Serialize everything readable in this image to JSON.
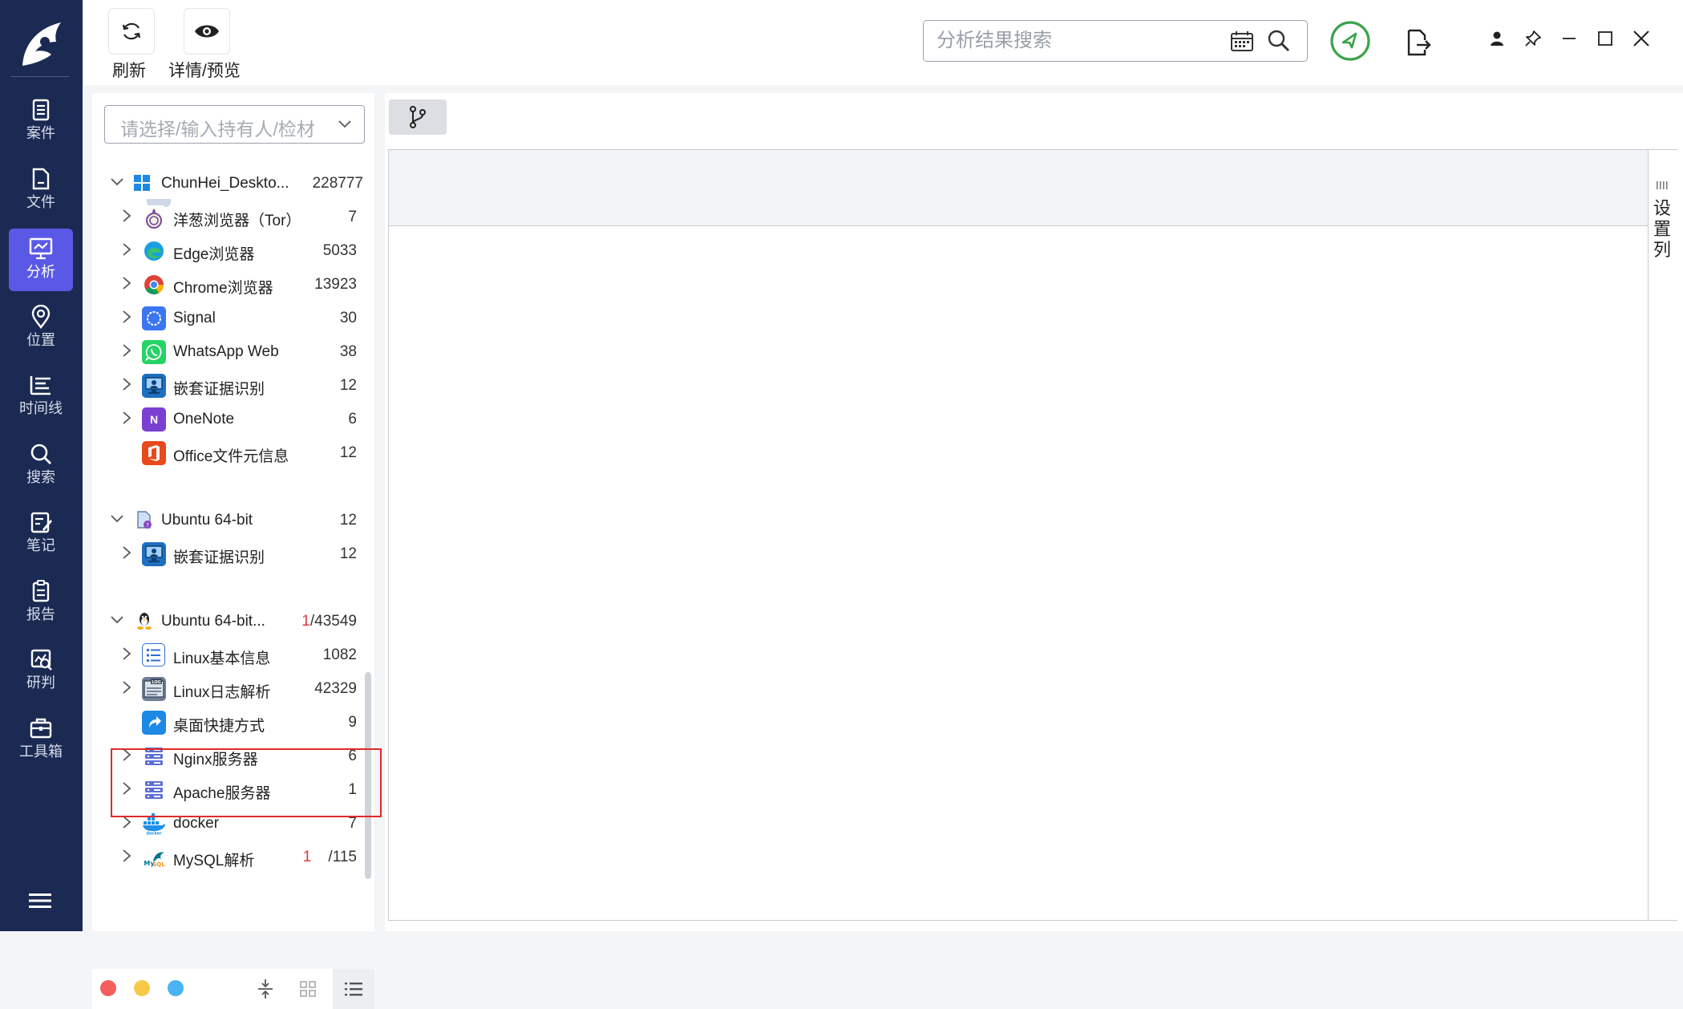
{
  "nav": {
    "items": [
      {
        "label": "案件",
        "icon": "case-icon"
      },
      {
        "label": "文件",
        "icon": "file-icon"
      },
      {
        "label": "分析",
        "icon": "analysis-icon",
        "active": true
      },
      {
        "label": "位置",
        "icon": "location-icon"
      },
      {
        "label": "时间线",
        "icon": "timeline-icon"
      },
      {
        "label": "搜索",
        "icon": "search-icon"
      },
      {
        "label": "笔记",
        "icon": "note-icon"
      },
      {
        "label": "报告",
        "icon": "report-icon"
      },
      {
        "label": "研判",
        "icon": "research-icon"
      },
      {
        "label": "工具箱",
        "icon": "toolbox-icon"
      }
    ]
  },
  "toolbar": {
    "refresh_label": "刷新",
    "preview_label": "详情/预览",
    "search_placeholder": "分析结果搜索"
  },
  "tree": {
    "selector_placeholder": "请选择/输入持有人/检材",
    "devices": [
      {
        "name": "ChunHei_Deskto...",
        "count": "228777",
        "children": [
          {
            "name": "洋葱浏览器（Tor）",
            "count": "7"
          },
          {
            "name": "Edge浏览器",
            "count": "5033"
          },
          {
            "name": "Chrome浏览器",
            "count": "13923"
          },
          {
            "name": "Signal",
            "count": "30"
          },
          {
            "name": "WhatsApp Web",
            "count": "38"
          },
          {
            "name": "嵌套证据识别",
            "count": "12"
          },
          {
            "name": "OneNote",
            "count": "6"
          },
          {
            "name": "Office文件元信息",
            "count": "12"
          }
        ]
      },
      {
        "name": "Ubuntu 64-bit",
        "count": "12",
        "children": [
          {
            "name": "嵌套证据识别",
            "count": "12"
          }
        ]
      },
      {
        "name": "Ubuntu 64-bit...",
        "count_highlight": "1",
        "count": "/43549",
        "children": [
          {
            "name": "Linux基本信息",
            "count": "1082"
          },
          {
            "name": "Linux日志解析",
            "count": "42329"
          },
          {
            "name": "桌面快捷方式",
            "count": "9"
          },
          {
            "name": "Nginx服务器",
            "count": "6"
          },
          {
            "name": "Apache服务器",
            "count": "1"
          },
          {
            "name": "docker",
            "count": "7"
          },
          {
            "name": "MySQL解析",
            "count_highlight": "1",
            "count": "/115"
          }
        ]
      }
    ]
  },
  "content": {
    "settings_column_label": "设置列"
  },
  "colors": {
    "nav_bg": "#1b2a52",
    "nav_active": "#5a59e6",
    "highlight_box": "#e02a2a",
    "status_green": "#3aa34a"
  }
}
